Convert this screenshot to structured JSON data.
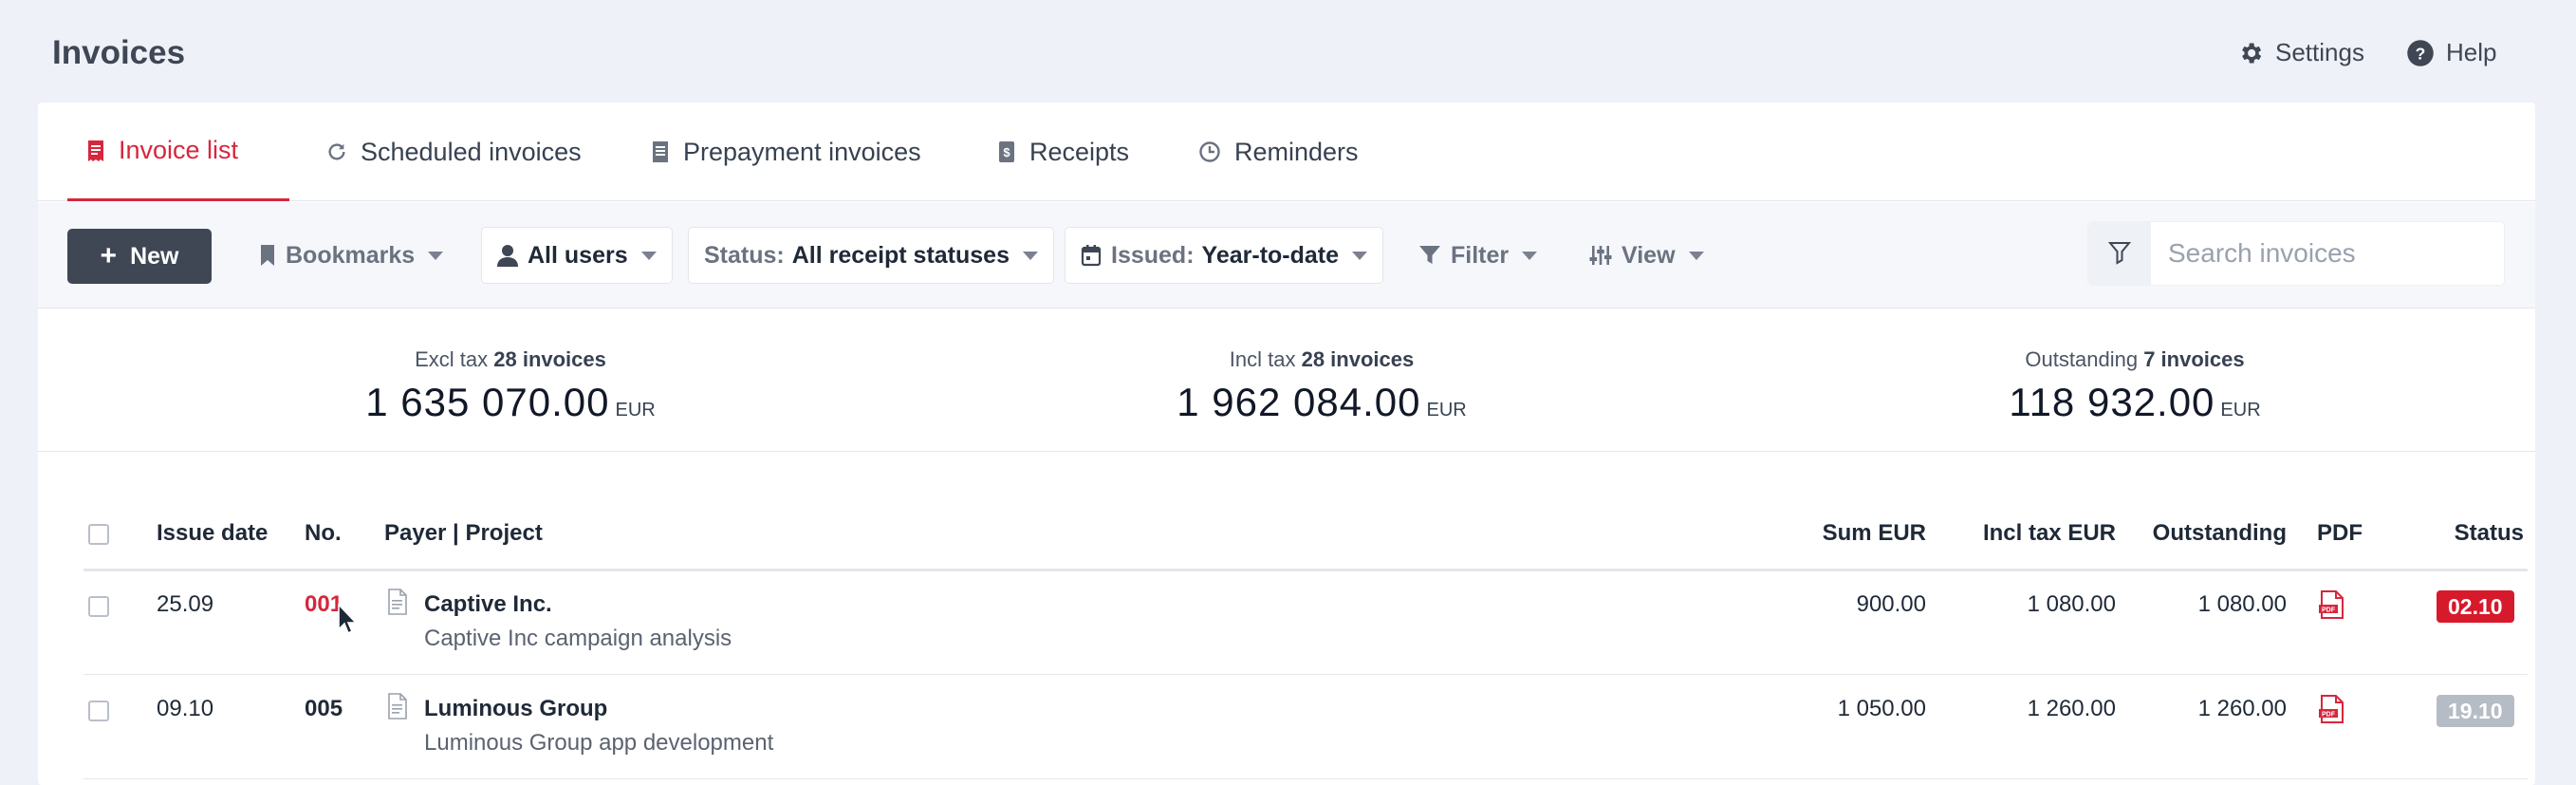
{
  "page": {
    "title": "Invoices"
  },
  "header": {
    "settings_label": "Settings",
    "help_label": "Help",
    "settings_icon": "gear-icon",
    "help_icon": "question-circle-icon"
  },
  "tabs": [
    {
      "label": "Invoice list",
      "icon": "invoice-icon",
      "active": true
    },
    {
      "label": "Scheduled invoices",
      "icon": "refresh-icon",
      "active": false
    },
    {
      "label": "Prepayment invoices",
      "icon": "document-icon",
      "active": false
    },
    {
      "label": "Receipts",
      "icon": "receipt-icon",
      "active": false
    },
    {
      "label": "Reminders",
      "icon": "clock-icon",
      "active": false
    }
  ],
  "toolbar": {
    "new_label": "New",
    "bookmarks_label": "Bookmarks",
    "users_label": "All users",
    "status_prefix": "Status:",
    "status_value": "All receipt statuses",
    "issued_prefix": "Issued:",
    "issued_value": "Year-to-date",
    "filter_label": "Filter",
    "view_label": "View"
  },
  "search": {
    "placeholder": "Search invoices"
  },
  "summary": [
    {
      "label": "Excl tax",
      "count": "28 invoices",
      "value": "1 635 070.00",
      "currency": "EUR"
    },
    {
      "label": "Incl tax",
      "count": "28 invoices",
      "value": "1 962 084.00",
      "currency": "EUR"
    },
    {
      "label": "Outstanding",
      "count": "7 invoices",
      "value": "118 932.00",
      "currency": "EUR"
    }
  ],
  "table": {
    "columns": {
      "issue_date": "Issue date",
      "no": "No.",
      "payer_project": "Payer | Project",
      "sum": "Sum EUR",
      "incl_tax": "Incl tax EUR",
      "outstanding": "Outstanding",
      "pdf": "PDF",
      "status": "Status"
    },
    "rows": [
      {
        "issue_date": "25.09",
        "no": "001",
        "payer": "Captive Inc.",
        "project": "Captive Inc campaign analysis",
        "sum": "900.00",
        "incl_tax": "1 080.00",
        "outstanding": "1 080.00",
        "status": "02.10",
        "status_color": "#d7192c"
      },
      {
        "issue_date": "09.10",
        "no": "005",
        "payer": "Luminous Group",
        "project": "Luminous Group app development",
        "sum": "1 050.00",
        "incl_tax": "1 260.00",
        "outstanding": "1 260.00",
        "status": "19.10",
        "status_color": "#b6bcc6"
      }
    ]
  },
  "colors": {
    "accent": "#d7263d",
    "dark_button": "#3f4654",
    "overdue": "#d7192c",
    "pending": "#b6bcc6"
  }
}
